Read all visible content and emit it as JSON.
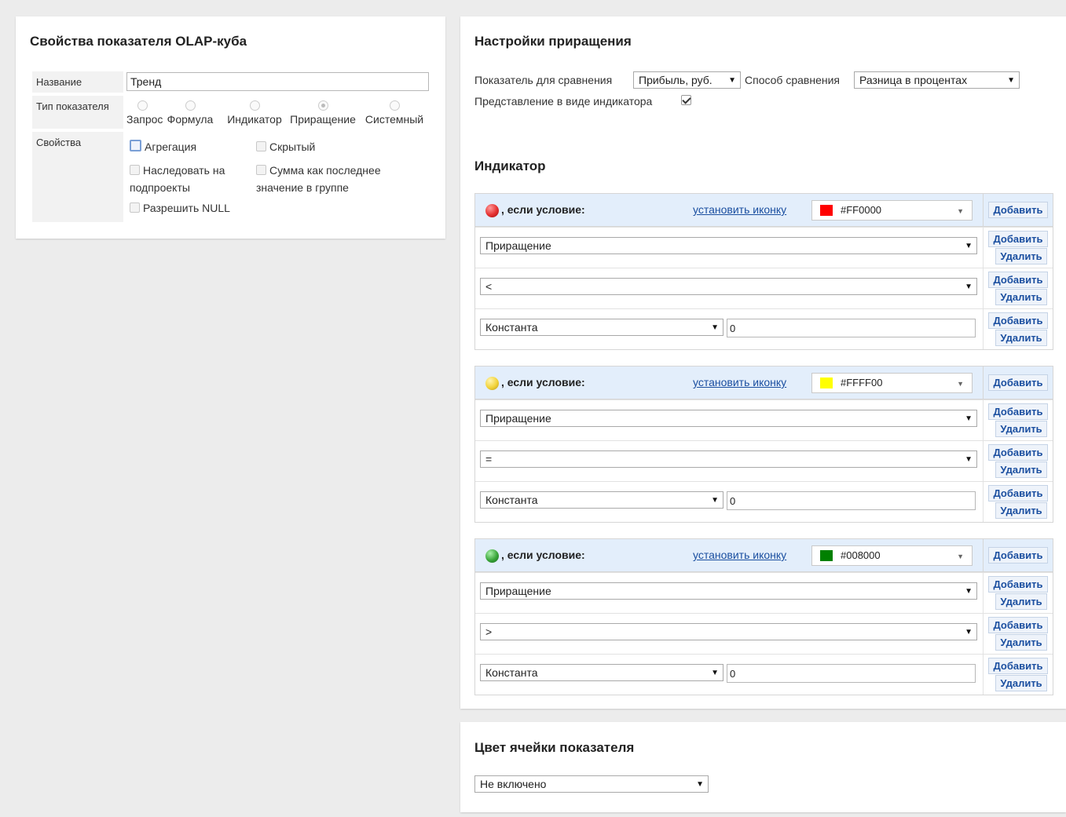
{
  "left_panel": {
    "title": "Свойства показателя OLAP-куба",
    "name_label": "Название",
    "name_value": "Тренд",
    "type_label": "Тип показателя",
    "types": [
      "Запрос",
      "Формула",
      "Индикатор",
      "Приращение",
      "Системный"
    ],
    "selected_type": "Приращение",
    "props_label": "Свойства",
    "props": {
      "aggregation": "Агрегация",
      "hidden": "Скрытый",
      "inherit_line1": "Наследовать на",
      "inherit_line2": "подпроекты",
      "sum_last_line1": "Сумма как последнее",
      "sum_last_line2": "значение в группе",
      "allow_null": "Разрешить NULL"
    }
  },
  "increment": {
    "title": "Настройки приращения",
    "compare_label": "Показатель для сравнения",
    "compare_value": "Прибыль, руб.",
    "method_label": "Способ сравнения",
    "method_value": "Разница в процентах",
    "as_indicator_label": "Представление в виде индикатора",
    "as_indicator_checked": true
  },
  "indicator": {
    "title": "Индикатор",
    "condition_label": ", если условие:",
    "set_icon_link": "установить иконку",
    "add_label": "Добавить",
    "delete_label": "Удалить",
    "blocks": [
      {
        "ball_color": "#e53030",
        "color_hex": "#FF0000",
        "swatch": "#ff0000",
        "field": "Приращение",
        "operator": "<",
        "operand_type": "Константа",
        "operand_value": "0"
      },
      {
        "ball_color": "#f2d33a",
        "color_hex": "#FFFF00",
        "swatch": "#ffff00",
        "field": "Приращение",
        "operator": "=",
        "operand_type": "Константа",
        "operand_value": "0"
      },
      {
        "ball_color": "#3aa53a",
        "color_hex": "#008000",
        "swatch": "#008000",
        "field": "Приращение",
        "operator": ">",
        "operand_type": "Константа",
        "operand_value": "0"
      }
    ]
  },
  "cell_color": {
    "title": "Цвет ячейки показателя",
    "value": "Не включено"
  }
}
